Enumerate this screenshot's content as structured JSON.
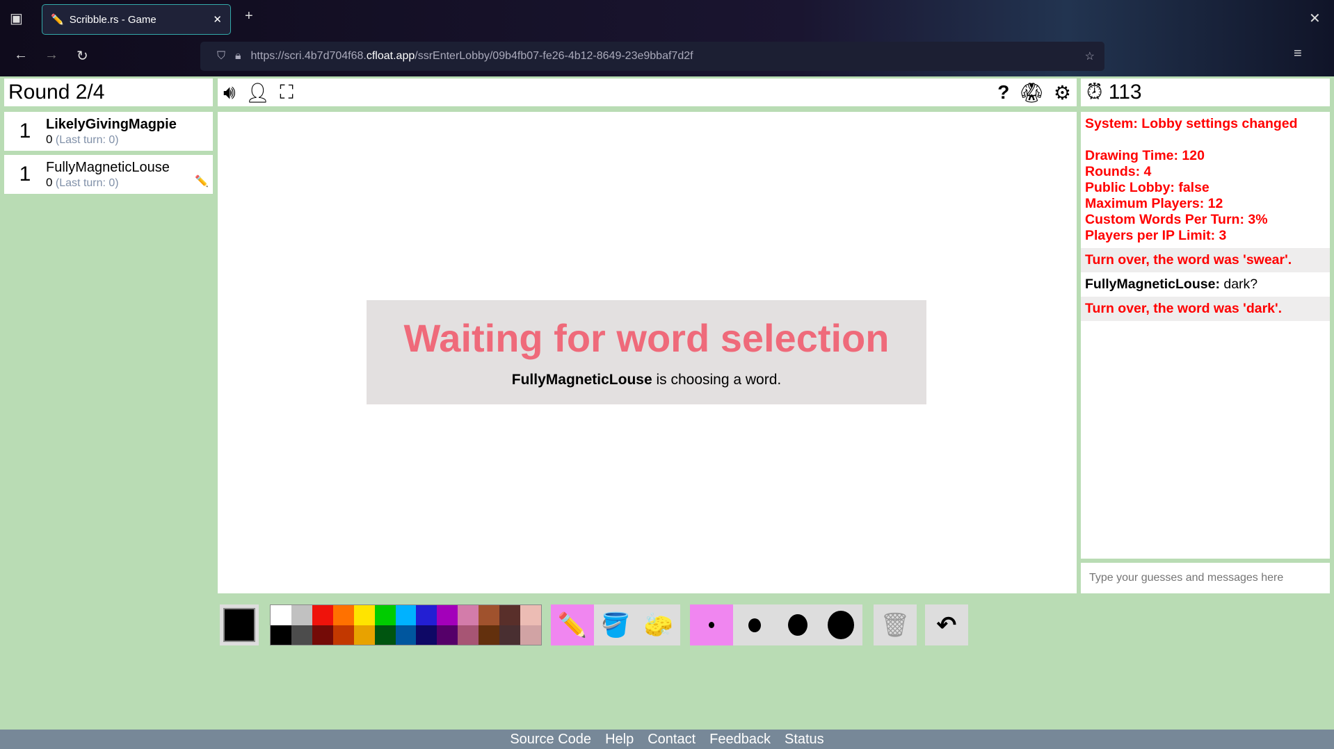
{
  "browser": {
    "tab_title": "Scribble.rs - Game",
    "url_prefix": "https://scri.4b7d704f68.",
    "url_host": "cfloat.app",
    "url_path": "/ssrEnterLobby/09b4fb07-fe26-4b12-8649-23e9bbaf7d2f"
  },
  "round": "Round 2/4",
  "players": [
    {
      "rank": "1",
      "name": "LikelyGivingMagpie",
      "score": "0",
      "last_turn": "(Last turn: 0)"
    },
    {
      "rank": "1",
      "name": "FullyMagneticLouse",
      "score": "0",
      "last_turn": "(Last turn: 0)"
    }
  ],
  "timer": "113",
  "overlay": {
    "title": "Waiting for word selection",
    "chooser": "FullyMagneticLouse",
    "suffix": " is choosing a word."
  },
  "chat": {
    "system": "System: Lobby settings changed",
    "settings": [
      "Drawing Time: 120",
      "Rounds: 4",
      "Public Lobby: false",
      "Maximum Players: 12",
      "Custom Words Per Turn: 3%",
      "Players per IP Limit: 3"
    ],
    "turn1": "Turn over, the word was 'swear'.",
    "guess_user": "FullyMagneticLouse:",
    "guess_text": " dark?",
    "turn2": "Turn over, the word was 'dark'.",
    "placeholder": "Type your guesses and messages here"
  },
  "palette_top": [
    "#ffffff",
    "#c1c1c1",
    "#ef130b",
    "#ff7100",
    "#ffe400",
    "#00cc00",
    "#00b2ff",
    "#231fd3",
    "#a300ba",
    "#d37caa",
    "#a0522d",
    "#592f2a",
    "#ecbcb4"
  ],
  "palette_bottom": [
    "#000000",
    "#4c4c4c",
    "#740b07",
    "#c23800",
    "#e8a200",
    "#005510",
    "#00569e",
    "#0e0865",
    "#550069",
    "#a75574",
    "#63300d",
    "#492f31",
    "#d1a3a4"
  ],
  "footer": [
    "Source Code",
    "Help",
    "Contact",
    "Feedback",
    "Status"
  ]
}
